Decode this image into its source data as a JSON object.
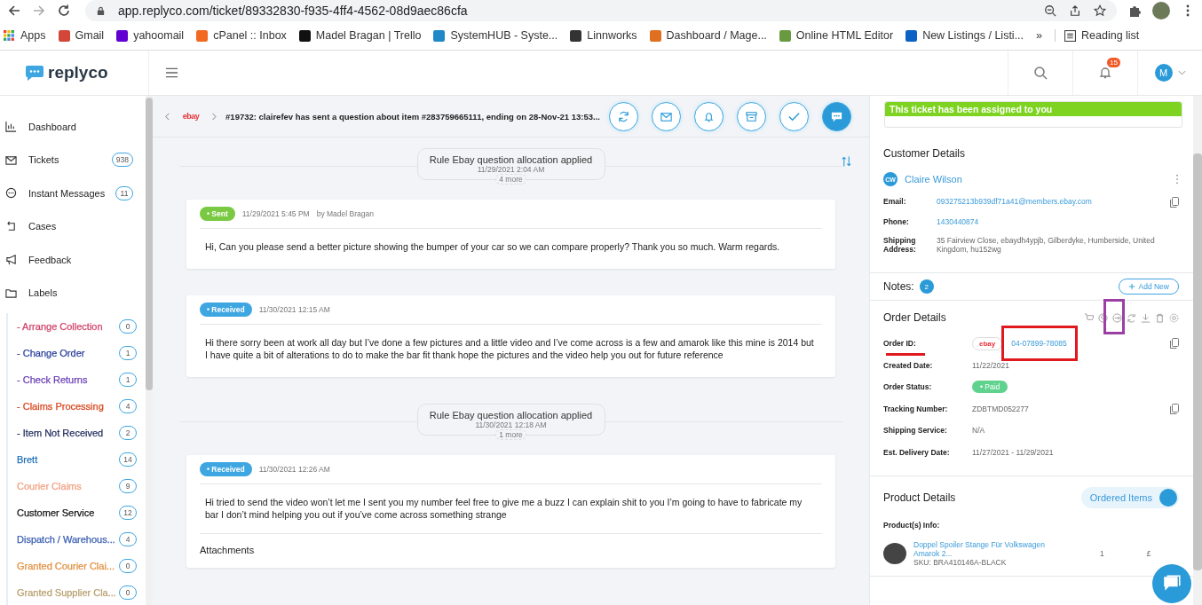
{
  "browser": {
    "url": "app.replyco.com/ticket/89332830-f935-4ff4-4562-08d9aec86cfa",
    "bookmarks": [
      "Apps",
      "Gmail",
      "yahoomail",
      "cPanel :: Inbox",
      "Madel Bragan | Trello",
      "SystemHUB - Syste...",
      "Linnworks",
      "Dashboard / Mage...",
      "Online HTML Editor",
      "New Listings / Listi..."
    ],
    "overflow": "»",
    "reading_list": "Reading list"
  },
  "app_header": {
    "logo": "replyco",
    "notification_count": "15",
    "avatar": "M"
  },
  "sidebar": {
    "nav": [
      {
        "label": "Dashboard"
      },
      {
        "label": "Tickets",
        "count": "938"
      },
      {
        "label": "Instant Messages",
        "count": "11"
      },
      {
        "label": "Cases"
      },
      {
        "label": "Feedback"
      },
      {
        "label": "Labels"
      }
    ],
    "labels": [
      {
        "label": "- Arrange Collection",
        "count": "0",
        "color": "#d0436a"
      },
      {
        "label": "- Change Order",
        "count": "1",
        "color": "#2a3f9a"
      },
      {
        "label": "- Check Returns",
        "count": "1",
        "color": "#6a3fb5"
      },
      {
        "label": "- Claims Processing",
        "count": "4",
        "color": "#d9441c"
      },
      {
        "label": "- Item Not Received",
        "count": "2",
        "color": "#1e2a5a"
      },
      {
        "label": "Brett",
        "count": "14",
        "color": "#1f6fb8"
      },
      {
        "label": "Courier Claims",
        "count": "9",
        "color": "#f0a080"
      },
      {
        "label": "Customer Service",
        "count": "12",
        "color": "#111111"
      },
      {
        "label": "Dispatch / Warehous...",
        "count": "4",
        "color": "#3a5eb0"
      },
      {
        "label": "Granted Courier Clai...",
        "count": "0",
        "color": "#e09040"
      },
      {
        "label": "Granted Supplier Cla...",
        "count": "0",
        "color": "#b8a070"
      }
    ]
  },
  "ticket": {
    "source_logo": "ebay",
    "title": "#19732: clairefev has sent a question about item #283759665111, ending on 28-Nov-21 13:53...",
    "timeline": [
      {
        "kind": "rule",
        "title": "Rule Ebay question allocation applied",
        "time": "11/29/2021 2:04 AM",
        "more": "4 more"
      },
      {
        "kind": "message",
        "status": {
          "label": "• Sent",
          "kind": "sent"
        },
        "time": "11/29/2021 5:45 PM",
        "author": "by Madel Bragan",
        "body": "Hi,   Can you please send a better picture showing the bumper of your car so we can compare properly?   Thank you so much.   Warm regards."
      },
      {
        "kind": "message",
        "status": {
          "label": "• Received",
          "kind": "received"
        },
        "time": "11/30/2021 12:15 AM",
        "body": "Hi there sorry been at work all day but I’ve done a few pictures and a little video and I’ve come across is a few and amarok like this mine is 2014 but I have quite a bit of alterations to do to make the bar fit thank hope the pictures and the video help you out for future reference"
      },
      {
        "kind": "rule",
        "title": "Rule Ebay question allocation applied",
        "time": "11/30/2021 12:18 AM",
        "more": "1 more"
      },
      {
        "kind": "message",
        "status": {
          "label": "• Received",
          "kind": "received"
        },
        "time": "11/30/2021 12:26 AM",
        "body": "Hi tried to send the video won’t let me I sent you my number feel free to give me a buzz I can explain shit to you I’m going to have to fabricate my bar I don’t mind helping you out if you’ve come across something strange",
        "attachments": "Attachments"
      }
    ]
  },
  "panel": {
    "assigned": "This ticket has been assigned to you",
    "customer": {
      "heading": "Customer Details",
      "initials": "CW",
      "name": "Claire Wilson",
      "fields": [
        {
          "label": "Email:",
          "value": "093275213b939df71a41@members.ebay.com",
          "kind": "link",
          "copy": true
        },
        {
          "label": "Phone:",
          "value": "1430440874",
          "kind": "link",
          "copy": false
        },
        {
          "label": "Shipping Address:",
          "value": "35 Fairview Close, ebaydh4ypjb, Gilberdyke, Humberside, United Kingdom, hu152wg",
          "kind": "text",
          "copy": false
        }
      ]
    },
    "notes": {
      "label": "Notes:",
      "count": "2",
      "add": "Add New"
    },
    "order": {
      "heading": "Order Details",
      "fields": [
        {
          "label": "Order ID:",
          "value": "04-07899-78085",
          "kind": "order_id",
          "logo": "ebay",
          "copy": true
        },
        {
          "label": "Created Date:",
          "value": "11/22/2021",
          "kind": "text",
          "copy": false
        },
        {
          "label": "Order Status:",
          "value": "• Paid",
          "kind": "badge",
          "copy": false
        },
        {
          "label": "Tracking Number:",
          "value": "ZDBTMD052277",
          "kind": "text",
          "copy": true
        },
        {
          "label": "Shipping Service:",
          "value": "N/A",
          "kind": "text",
          "copy": false
        },
        {
          "label": "Est. Delivery Date:",
          "value": "11/27/2021 - 11/29/2021",
          "kind": "text",
          "copy": false
        }
      ]
    },
    "product": {
      "heading": "Product Details",
      "toggle": {
        "label": "Ordered Items",
        "on": true
      },
      "info_label": "Product(s) Info:",
      "items": [
        {
          "name": "Doppel Spoiler Stange Für Volkswagen Amarok 2...",
          "sku": "SKU: BRA410146A-BLACK",
          "qty": "1",
          "price": "£"
        }
      ]
    }
  }
}
